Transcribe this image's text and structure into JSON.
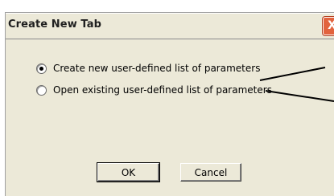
{
  "dialog": {
    "title": "Create New Tab",
    "close_label": "X",
    "options": [
      {
        "label": "Create new user-defined list of parameters",
        "checked": true
      },
      {
        "label": "Open existing user-defined list of parameters",
        "checked": false
      }
    ],
    "ok_label": "OK",
    "cancel_label": "Cancel"
  }
}
